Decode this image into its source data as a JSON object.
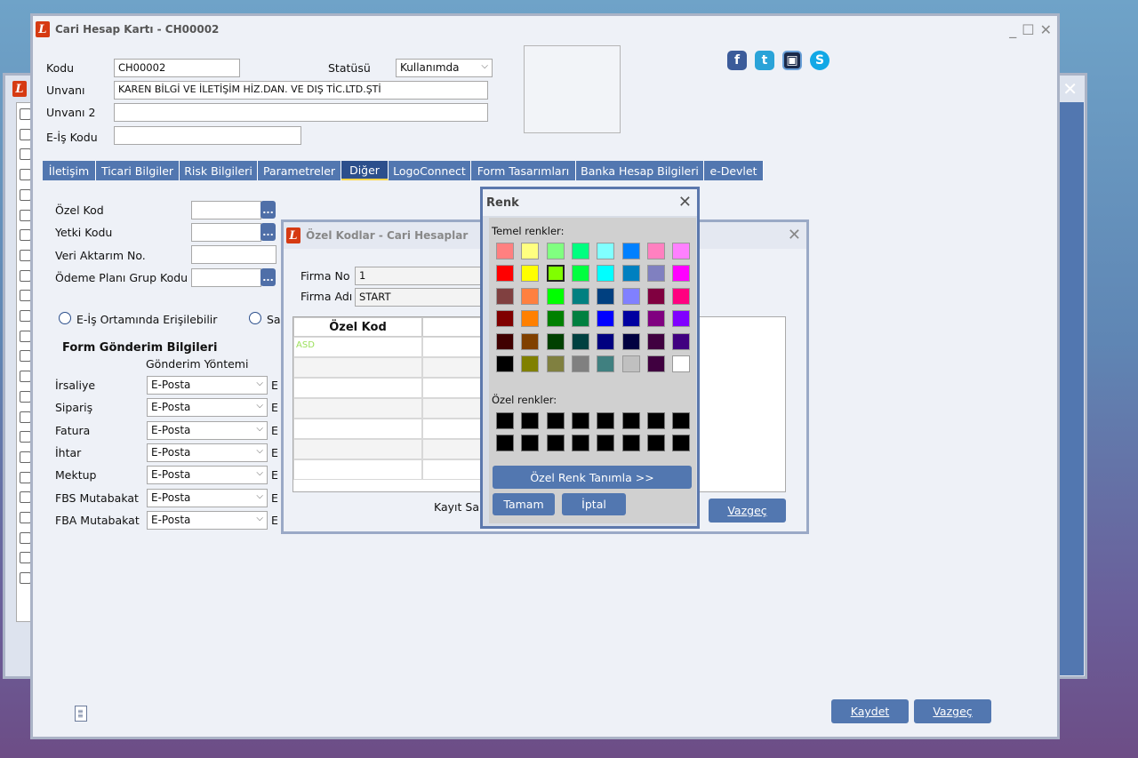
{
  "back_window": {},
  "main": {
    "title": "Cari Hesap Kartı - CH00002",
    "kodu_label": "Kodu",
    "kodu_value": "CH00002",
    "statusu_label": "Statüsü",
    "statusu_value": "Kullanımda",
    "unvani_label": "Unvanı",
    "unvani_value": "KAREN BİLGİ VE İLETİŞİM HİZ.DAN. VE DIŞ TİC.LTD.ŞTİ",
    "unvani2_label": "Unvanı 2",
    "eis_label": "E-İş Kodu",
    "social": [
      "facebook-icon",
      "twitter-icon",
      "logo-icon",
      "skype-icon"
    ],
    "tabs": [
      "İletişim",
      "Ticari Bilgiler",
      "Risk Bilgileri",
      "Parametreler",
      "Diğer",
      "LogoConnect",
      "Form Tasarımları",
      "Banka Hesap Bilgileri",
      "e-Devlet"
    ],
    "ozel_kod": "Özel Kod",
    "yetki_kodu": "Yetki Kodu",
    "veri_aktarim": "Veri Aktarım No.",
    "odeme_plani": "Ödeme Planı Grup Kodu",
    "dots": "...",
    "eis_erisilebilir": "E-İş Ortamında Erişilebilir",
    "sa_text": "Sa",
    "form_gonderim": "Form Gönderim Bilgileri",
    "gonderim_yontemi": "Gönderim Yöntemi",
    "rows": [
      {
        "label": "İrsaliye",
        "value": "E-Posta",
        "trail": "E"
      },
      {
        "label": "Sipariş",
        "value": "E-Posta",
        "trail": "E"
      },
      {
        "label": "Fatura",
        "value": "E-Posta",
        "trail": "E"
      },
      {
        "label": "İhtar",
        "value": "E-Posta",
        "trail": "E"
      },
      {
        "label": "Mektup",
        "value": "E-Posta",
        "trail": "E"
      },
      {
        "label": "FBS Mutabakat",
        "value": "E-Posta",
        "trail": "E"
      },
      {
        "label": "FBA Mutabakat",
        "value": "E-Posta",
        "trail": "E"
      }
    ],
    "kaydet": "Kaydet",
    "vazgec": "Vazgeç"
  },
  "ozel_kodlar": {
    "title": "Özel Kodlar - Cari Hesaplar",
    "firma_no_label": "Firma No",
    "firma_no_value": "1",
    "firma_adi_label": "Firma Adı",
    "firma_adi_value": "START",
    "col_header": "Özel Kod",
    "first_row": "ASD",
    "kayit_sa": "Kayıt Sa",
    "vazgec": "Vazgeç",
    "first_row_color": "#9be05a"
  },
  "renk": {
    "title": "Renk",
    "temel_label": "Temel renkler:",
    "ozel_label": "Özel renkler:",
    "ozel_tanimla": "Özel Renk Tanımla >>",
    "tamam": "Tamam",
    "iptal": "İptal",
    "selected_color": "#80ff00",
    "basic_colors": [
      "#ff8080",
      "#ffff80",
      "#80ff80",
      "#00ff80",
      "#80ffff",
      "#0080ff",
      "#ff80c0",
      "#ff80ff",
      "#ff0000",
      "#ffff00",
      "#80ff00",
      "#00ff40",
      "#00ffff",
      "#0080c0",
      "#8080c0",
      "#ff00ff",
      "#804040",
      "#ff8040",
      "#00ff00",
      "#008080",
      "#004080",
      "#8080ff",
      "#800040",
      "#ff0080",
      "#800000",
      "#ff8000",
      "#008000",
      "#008040",
      "#0000ff",
      "#0000a0",
      "#800080",
      "#8000ff",
      "#400000",
      "#804000",
      "#004000",
      "#004040",
      "#000080",
      "#000040",
      "#400040",
      "#400080",
      "#000000",
      "#808000",
      "#808040",
      "#808080",
      "#408080",
      "#c0c0c0",
      "#400040",
      "#ffffff"
    ]
  }
}
